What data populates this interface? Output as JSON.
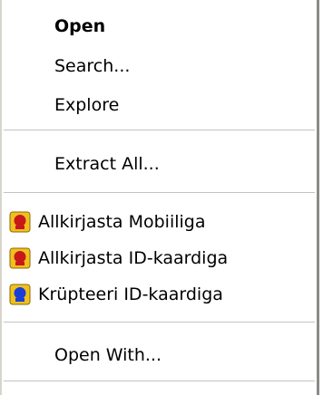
{
  "context_menu": {
    "items": [
      {
        "label": "Open",
        "bold": true
      },
      {
        "label": "Search..."
      },
      {
        "label": "Explore"
      },
      {
        "label": "Extract All..."
      },
      {
        "label": "Allkirjasta Mobiiliga",
        "icon": "id-card-red-icon"
      },
      {
        "label": "Allkirjasta ID-kaardiga",
        "icon": "id-card-red-icon"
      },
      {
        "label": "Krüpteeri ID-kaardiga",
        "icon": "id-card-blue-icon"
      },
      {
        "label": "Open With..."
      }
    ]
  },
  "colors": {
    "icon_red": "#c8181a",
    "icon_blue": "#1a3fd6",
    "icon_gold": "#f0c020",
    "separator": "#c6c3bc"
  }
}
